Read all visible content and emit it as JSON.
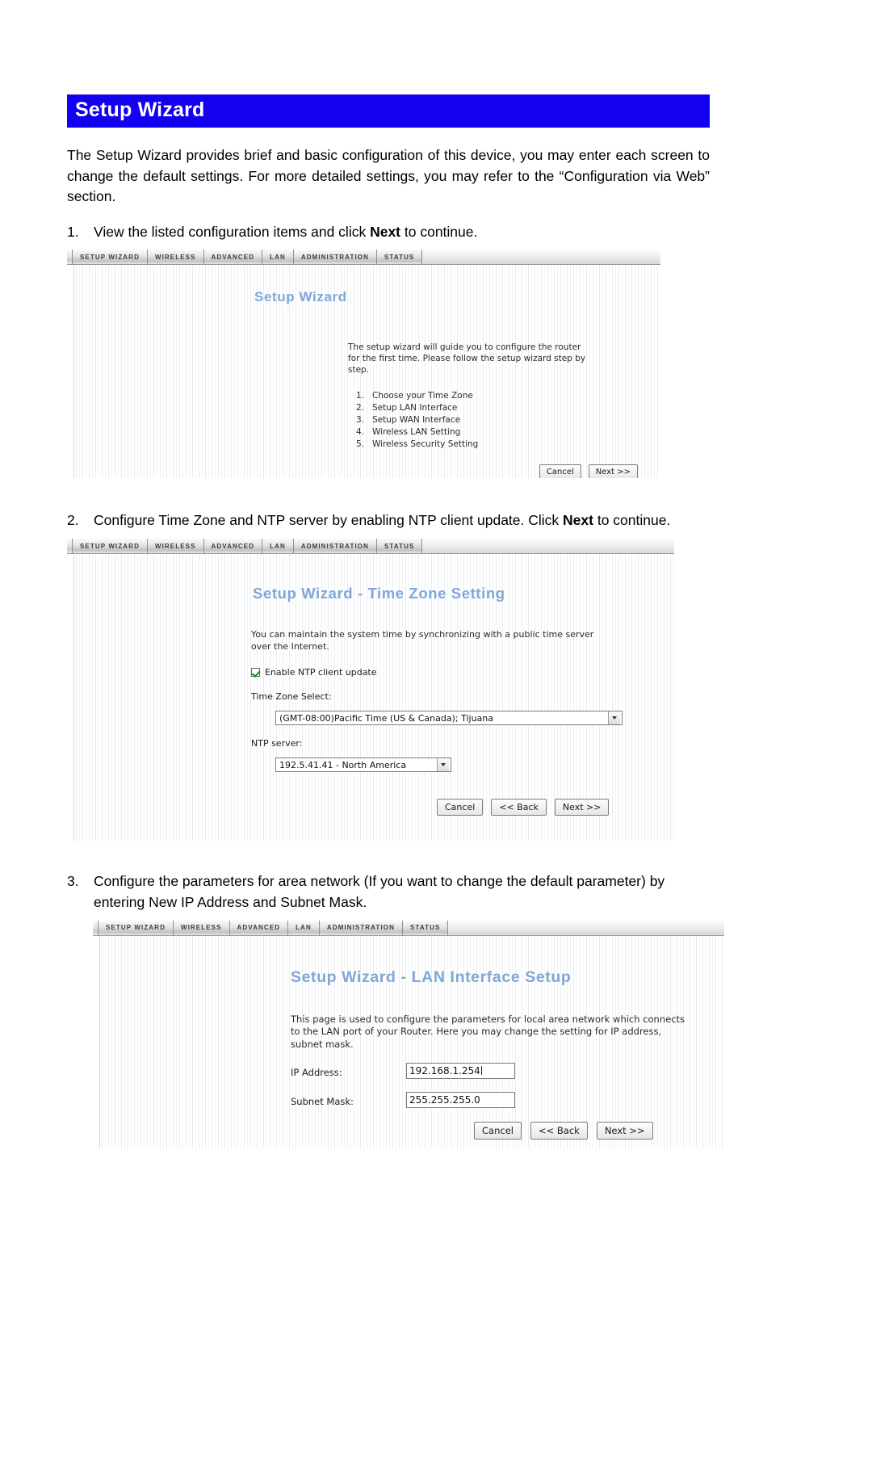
{
  "doc": {
    "title": "Setup Wizard",
    "intro": "The Setup Wizard provides brief and basic configuration of this device, you may enter each screen to change the default settings.  For more detailed settings, you may refer to the “Configuration via Web” section.",
    "steps": [
      {
        "num": "1.",
        "text_before": "View the listed configuration items and click ",
        "bold": "Next",
        "text_after": " to continue."
      },
      {
        "num": "2.",
        "text_before": "Configure Time Zone and NTP server by enabling NTP client update. Click ",
        "bold": "Next",
        "text_after": " to continue."
      },
      {
        "num": "3.",
        "text_before": "Configure the parameters for area network (If you want to change the default parameter) by entering New IP Address and Subnet Mask.",
        "bold": "",
        "text_after": ""
      }
    ]
  },
  "router_ui": {
    "tabs": [
      "Setup Wizard",
      "Wireless",
      "Advanced",
      "LAN",
      "Administration",
      "Status"
    ],
    "screen1": {
      "heading": "Setup Wizard",
      "blurb": "The setup wizard will guide you to configure the router for the first time. Please follow the setup wizard step by step.",
      "list": [
        {
          "num": "1.",
          "label": "Choose your Time Zone"
        },
        {
          "num": "2.",
          "label": "Setup LAN Interface"
        },
        {
          "num": "3.",
          "label": "Setup WAN Interface"
        },
        {
          "num": "4.",
          "label": "Wireless LAN Setting"
        },
        {
          "num": "5.",
          "label": "Wireless Security Setting"
        }
      ],
      "buttons": {
        "cancel": "Cancel",
        "next": "Next >>"
      }
    },
    "screen2": {
      "heading": "Setup Wizard - Time Zone Setting",
      "blurb": "You can maintain the system time by synchronizing with a public time server over the Internet.",
      "checkbox_label": "Enable NTP client update",
      "checkbox_checked": true,
      "timezone_label": "Time Zone Select:",
      "timezone_value": "(GMT-08:00)Pacific Time (US & Canada); Tijuana",
      "ntp_label": "NTP server:",
      "ntp_value": "192.5.41.41 - North America",
      "buttons": {
        "cancel": "Cancel",
        "back": "<< Back",
        "next": "Next >>"
      }
    },
    "screen3": {
      "heading": "Setup Wizard - LAN Interface Setup",
      "blurb": "This page is used to configure the parameters for local area network which connects to the LAN port of your Router. Here you may change the setting for IP address, subnet mask.",
      "ip_label": "IP Address:",
      "ip_value": "192.168.1.254",
      "mask_label": "Subnet Mask:",
      "mask_value": "255.255.255.0",
      "buttons": {
        "cancel": "Cancel",
        "back": "<< Back",
        "next": "Next >>"
      }
    }
  },
  "colors": {
    "banner_bg": "#1400f0",
    "banner_fg": "#ffffff",
    "ui_heading": "#7fa7d8"
  }
}
